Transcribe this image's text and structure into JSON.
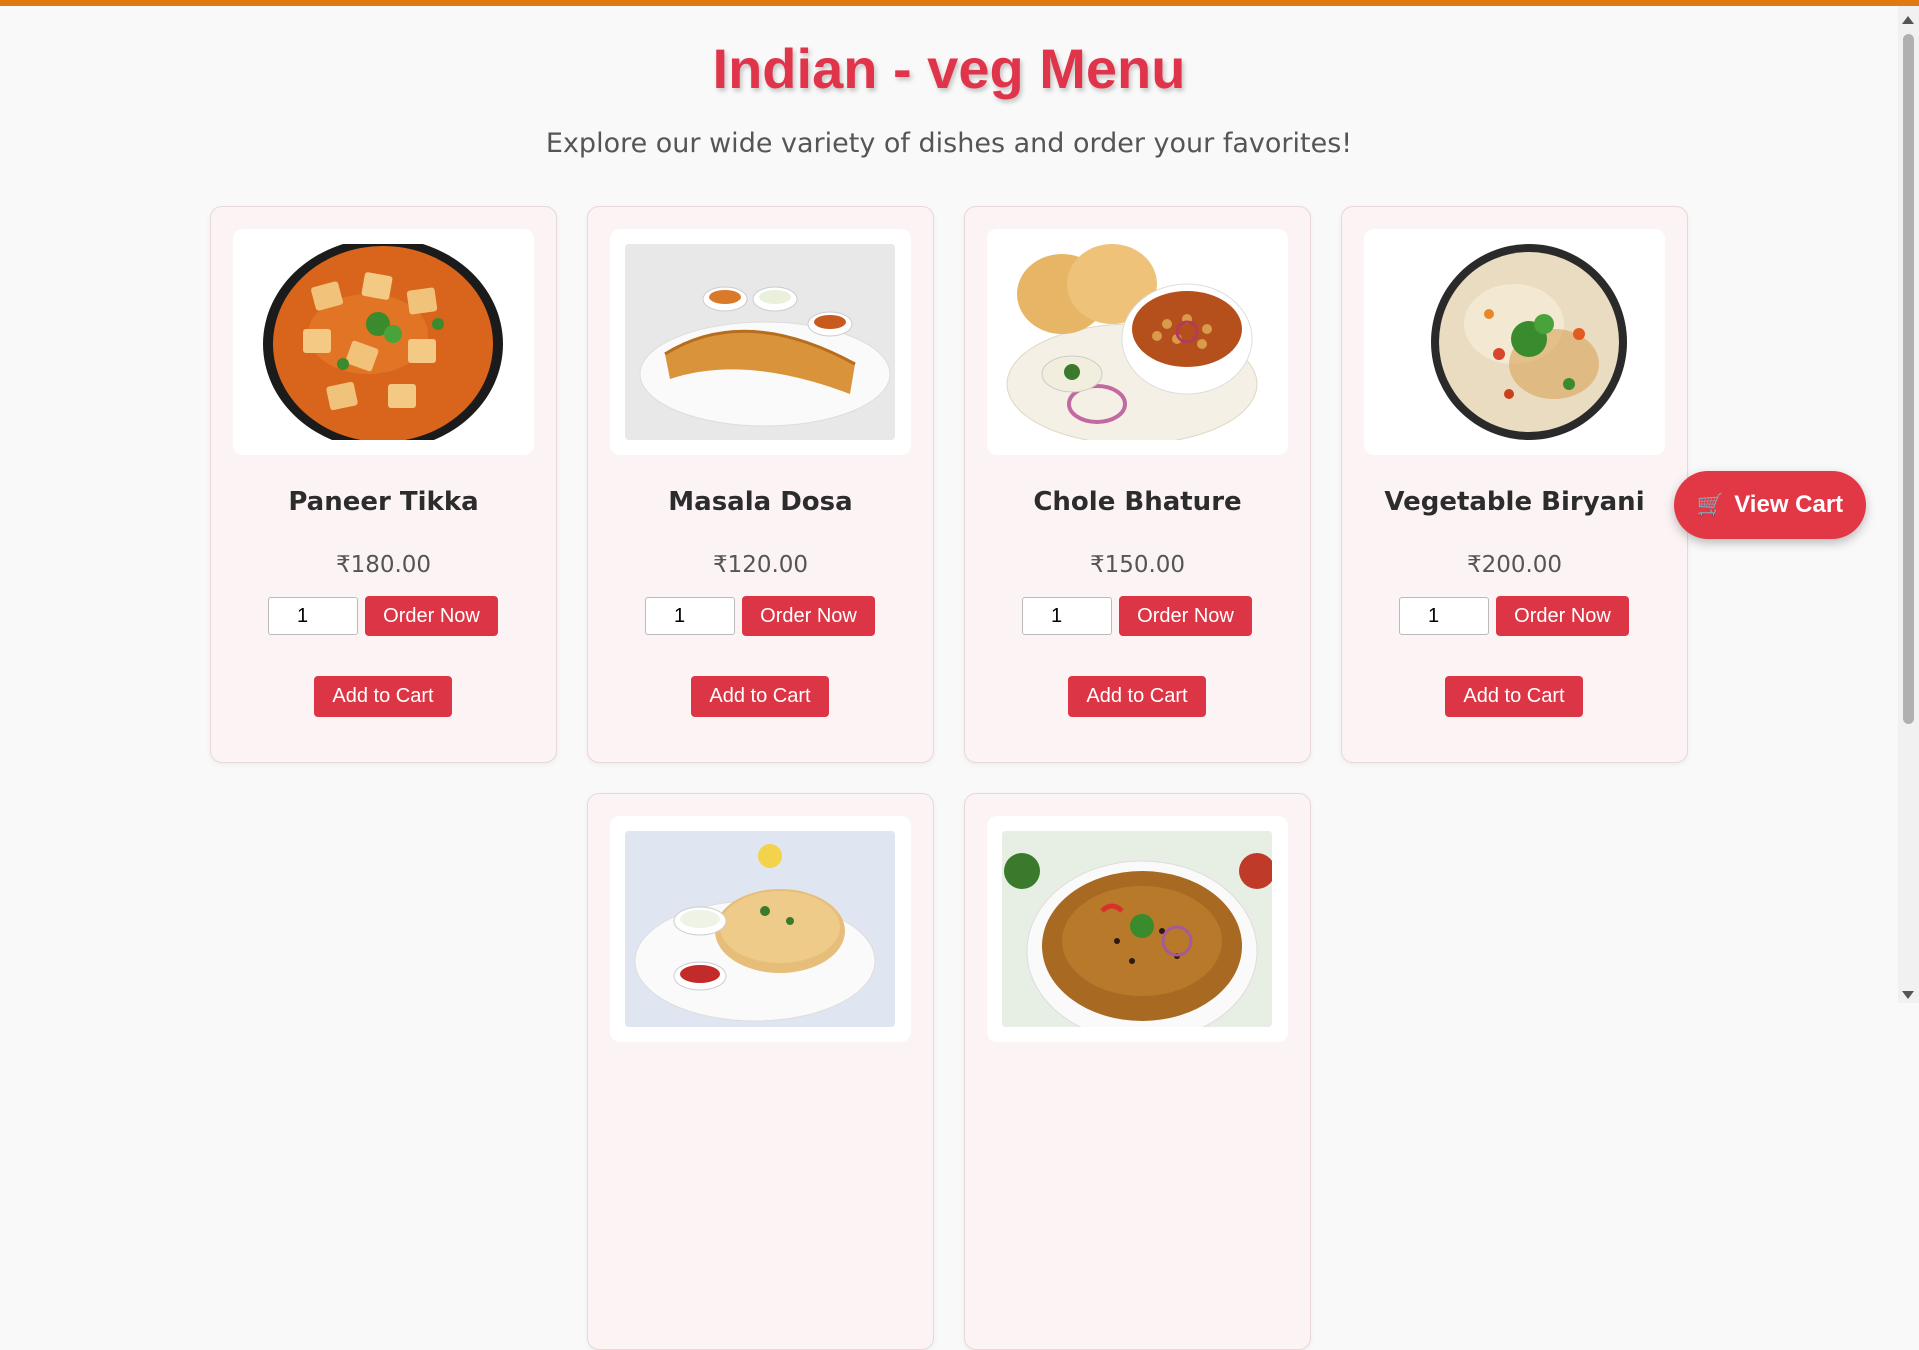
{
  "page": {
    "title": "Indian - veg Menu",
    "subtitle": "Explore our wide variety of dishes and order your favorites!"
  },
  "view_cart": {
    "label": "View Cart",
    "icon": "shopping-cart-icon"
  },
  "buttons": {
    "order_label": "Order Now",
    "cart_label": "Add to Cart"
  },
  "items": [
    {
      "name": "Paneer Tikka",
      "price": "₹180.00",
      "qty": "1",
      "image": "paneer-tikka-image"
    },
    {
      "name": "Masala Dosa",
      "price": "₹120.00",
      "qty": "1",
      "image": "masala-dosa-image"
    },
    {
      "name": "Chole Bhature",
      "price": "₹150.00",
      "qty": "1",
      "image": "chole-bhature-image"
    },
    {
      "name": "Vegetable Biryani",
      "price": "₹200.00",
      "qty": "1",
      "image": "vegetable-biryani-image"
    },
    {
      "image": "paratha-image"
    },
    {
      "image": "dal-makhani-image"
    }
  ],
  "colors": {
    "accent": "#dc3545",
    "title": "#e0344a",
    "top_border": "#e07a10"
  }
}
